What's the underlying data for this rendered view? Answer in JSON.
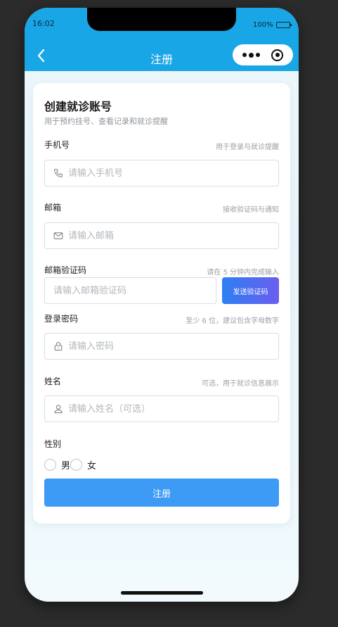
{
  "status_bar": {
    "time": "16:02",
    "battery": "100%"
  },
  "nav": {
    "title": "注册",
    "back_icon": "chevron-left-icon",
    "more_icon": "more-dots-icon",
    "close_icon": "target-circle-icon"
  },
  "form": {
    "title": "创建就诊账号",
    "subtitle": "用于预约挂号、查看记录和就诊提醒",
    "phone": {
      "label": "手机号",
      "hint": "用于登录与就诊提醒",
      "placeholder": "请输入手机号",
      "icon": "phone-icon"
    },
    "email": {
      "label": "邮箱",
      "hint": "接收验证码与通知",
      "placeholder": "请输入邮箱",
      "icon": "mail-icon"
    },
    "email_code": {
      "label": "邮箱验证码",
      "hint": "请在 5 分钟内完成输入",
      "placeholder": "请输入邮箱验证码",
      "send_button": "发送验证码"
    },
    "password": {
      "label": "登录密码",
      "hint": "至少 6 位，建议包含字母数字",
      "placeholder": "请输入密码",
      "icon": "lock-icon"
    },
    "name": {
      "label": "姓名",
      "hint": "可选，用于就诊信息展示",
      "placeholder": "请输入姓名（可选）",
      "icon": "user-icon"
    },
    "gender": {
      "label": "性别",
      "options": [
        "男",
        "女"
      ]
    },
    "submit": "注册"
  },
  "colors": {
    "header": "#18a6e6",
    "primary_button": "#3d9bf5",
    "send_code_gradient_start": "#2e7ff2",
    "send_code_gradient_end": "#6a5ef0"
  }
}
